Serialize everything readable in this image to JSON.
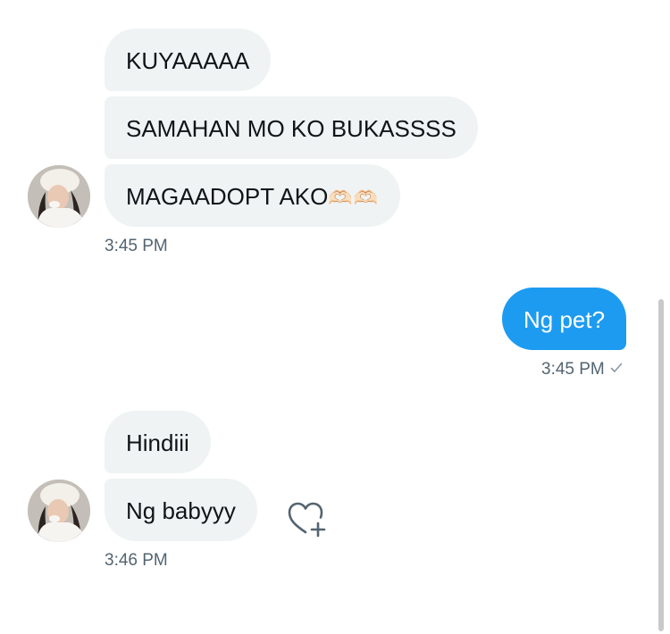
{
  "conversation": {
    "groups": [
      {
        "sender": "them",
        "messages": [
          {
            "text": "KUYAAAAA"
          },
          {
            "text": "SAMAHAN MO KO BUKASSSS"
          },
          {
            "text": "MAGAADOPT AKO",
            "emoji": "🫶🏻🫶🏻"
          }
        ],
        "time": "3:45 PM",
        "avatar_icon": "user-avatar"
      },
      {
        "sender": "me",
        "messages": [
          {
            "text": "Ng pet?"
          }
        ],
        "time": "3:45 PM",
        "status_icon": "sent-check-icon"
      },
      {
        "sender": "them",
        "messages": [
          {
            "text": "Hindiii"
          },
          {
            "text": "Ng babyyy"
          }
        ],
        "time": "3:46 PM",
        "avatar_icon": "user-avatar",
        "reaction_icon": "heart-plus-icon"
      }
    ]
  },
  "colors": {
    "incoming_bubble": "#eff3f4",
    "outgoing_bubble": "#1d9bf0",
    "timestamp": "#536471",
    "text": "#0f1419"
  }
}
